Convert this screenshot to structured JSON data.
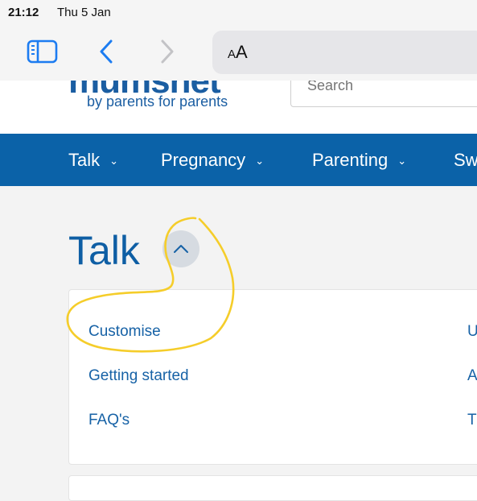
{
  "status_bar": {
    "time": "21:12",
    "date": "Thu 5 Jan"
  },
  "browser": {
    "icons": {
      "sidebar": "sidebar-icon",
      "back": "chevron-left-icon",
      "forward": "chevron-right-icon"
    },
    "reader_button_label_small": "A",
    "reader_button_label_large": "A"
  },
  "site": {
    "logo_text": "mumsnet",
    "tagline": "by parents for parents",
    "search_placeholder": "Search"
  },
  "nav": {
    "items": [
      {
        "label": "Talk",
        "chevron": "⌄"
      },
      {
        "label": "Pregnancy",
        "chevron": "⌄"
      },
      {
        "label": "Parenting",
        "chevron": "⌄"
      },
      {
        "label": "Sw"
      }
    ]
  },
  "talk": {
    "title": "Talk",
    "collapse_icon": "chevron-up-icon",
    "links_left": [
      "Customise",
      "Getting started",
      "FAQ's"
    ],
    "links_right": [
      "U",
      "A",
      "T"
    ]
  },
  "annotation": {
    "color": "#f5cd2a"
  },
  "colors": {
    "brand_blue": "#0b62a8",
    "link_blue": "#1762a6"
  }
}
